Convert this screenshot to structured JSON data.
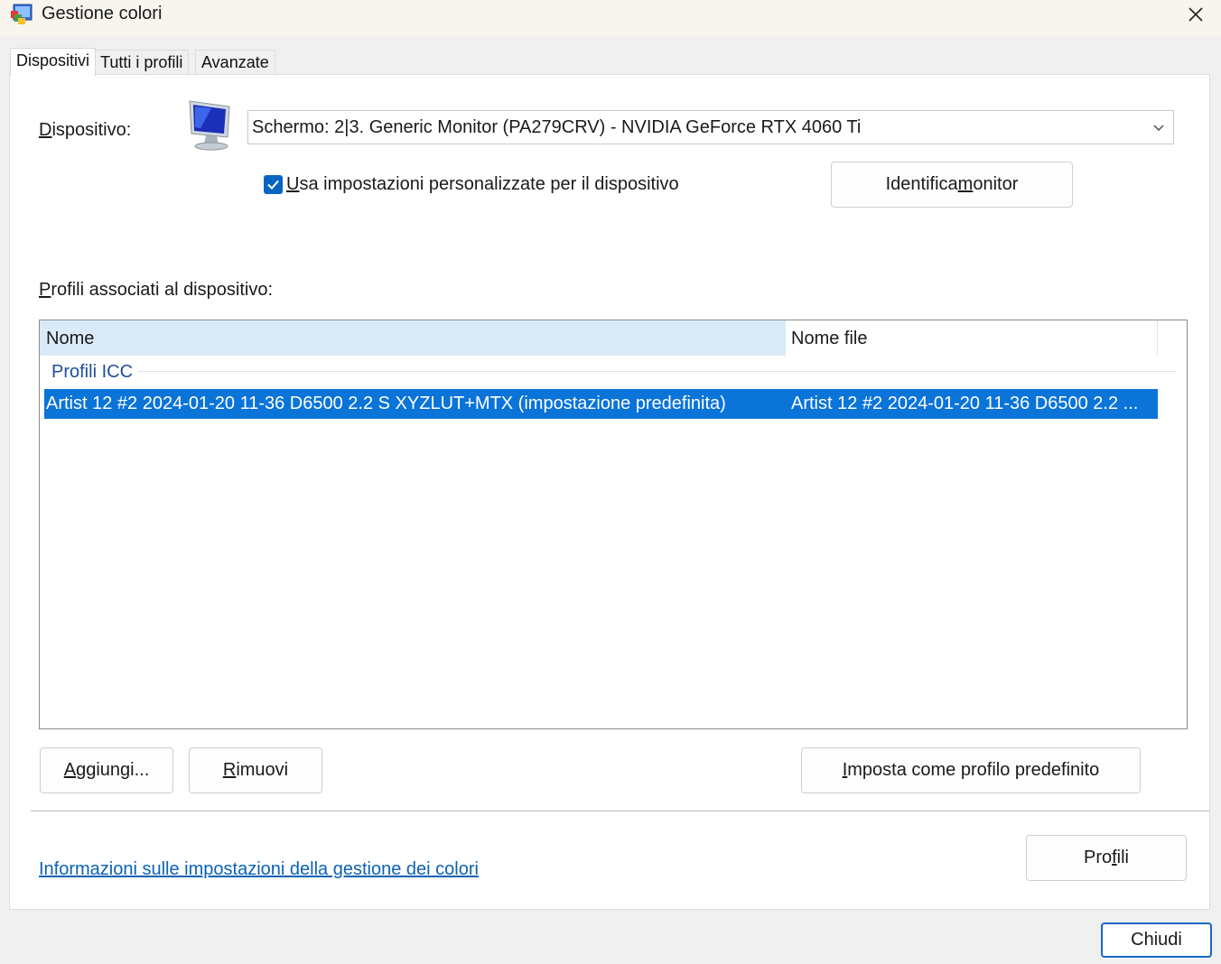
{
  "window": {
    "title": "Gestione colori"
  },
  "tabs": [
    {
      "label": "Dispositivi",
      "active": true
    },
    {
      "label": "Tutti i profili",
      "active": false
    },
    {
      "label": "Avanzate",
      "active": false
    }
  ],
  "device": {
    "label_pre": "",
    "label_key": "D",
    "label_post": "ispositivo:",
    "selected": "Schermo: 2|3. Generic Monitor (PA279CRV) - NVIDIA GeForce RTX 4060 Ti"
  },
  "custom_settings": {
    "checked": true,
    "label_key": "U",
    "label_post": "sa impostazioni personalizzate per il dispositivo"
  },
  "identify_button": {
    "pre": "Identifica ",
    "key": "m",
    "post": "onitor"
  },
  "profiles_section": {
    "label_key": "P",
    "label_post": "rofili associati al dispositivo:"
  },
  "table": {
    "columns": [
      "Nome",
      "Nome file"
    ],
    "group": "Profili ICC",
    "rows": [
      {
        "name": "Artist 12 #2 2024-01-20 11-36 D6500 2.2 S XYZLUT+MTX (impostazione predefinita)",
        "file": "Artist 12 #2 2024-01-20 11-36 D6500 2.2 ...",
        "selected": true
      }
    ]
  },
  "buttons": {
    "add": {
      "key": "A",
      "post": "ggiungi..."
    },
    "remove": {
      "key": "R",
      "post": "imuovi"
    },
    "set_default": {
      "key": "I",
      "post": "mposta come profilo predefinito"
    },
    "profiles": {
      "pre": "Pro",
      "key": "f",
      "post": "ili"
    },
    "close": "Chiudi"
  },
  "info_link": "Informazioni sulle impostazioni della gestione dei colori",
  "colors": {
    "accent": "#0a74d9",
    "header_highlight": "#d9eaf8",
    "link": "#0b62b4",
    "group_text": "#1e4e9a"
  },
  "icons": [
    "color-management-app-icon",
    "close-icon",
    "monitor-icon",
    "chevron-down-icon",
    "checkmark-icon"
  ]
}
